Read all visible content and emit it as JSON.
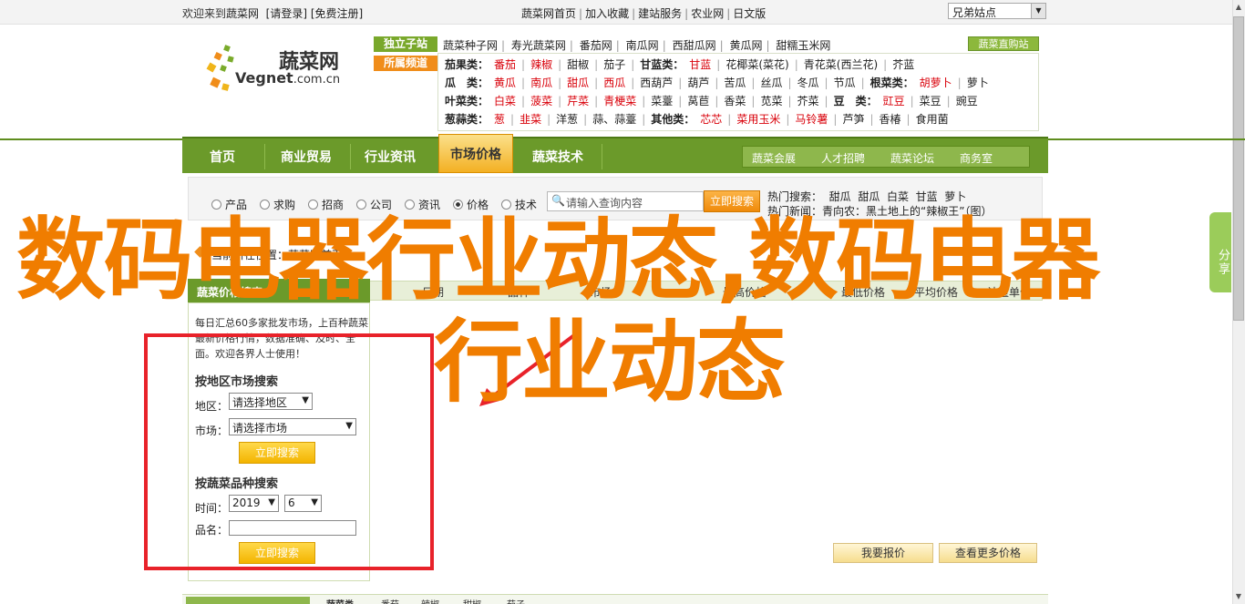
{
  "topbar": {
    "welcome": "欢迎来到",
    "site": "蔬菜网",
    "login": "[请登录]",
    "register": "[免费注册]",
    "links": [
      "蔬菜网首页",
      "加入收藏",
      "建站服务",
      "农业网",
      "日文版"
    ],
    "skin": "兄弟姑点"
  },
  "logo": {
    "cn": "蔬菜网",
    "en_a": "Vegnet",
    "en_b": ".com.cn"
  },
  "header": {
    "tag1": "独立子站",
    "tag2": "所属频道",
    "sites": [
      "蔬菜种子网",
      "寿光蔬菜网",
      "番茄网",
      "南瓜网",
      "西甜瓜网",
      "黄瓜网",
      "甜糯玉米网"
    ],
    "direct": "蔬菜直购站"
  },
  "veg_rows": [
    {
      "head": "茄果类：",
      "items": [
        [
          "番茄",
          true
        ],
        [
          "辣椒",
          true
        ],
        [
          "甜椒",
          false
        ],
        [
          "茄子",
          false
        ]
      ],
      "head2": "甘蓝类：",
      "items2": [
        [
          "甘蓝",
          true
        ],
        [
          "花椰菜(菜花)",
          false
        ],
        [
          "青花菜(西兰花)",
          false
        ],
        [
          "芥蓝",
          false
        ]
      ]
    },
    {
      "head": "瓜　类：",
      "items": [
        [
          "黄瓜",
          true
        ],
        [
          "南瓜",
          true
        ],
        [
          "甜瓜",
          true
        ],
        [
          "西瓜",
          true
        ],
        [
          "西葫芦",
          false
        ],
        [
          "葫芦",
          false
        ],
        [
          "苦瓜",
          false
        ],
        [
          "丝瓜",
          false
        ],
        [
          "冬瓜",
          false
        ],
        [
          "节瓜",
          false
        ]
      ],
      "head2": "根菜类：",
      "items2": [
        [
          "胡萝卜",
          true
        ],
        [
          "萝卜",
          false
        ]
      ]
    },
    {
      "head": "叶菜类：",
      "items": [
        [
          "白菜",
          true
        ],
        [
          "菠菜",
          true
        ],
        [
          "芹菜",
          true
        ],
        [
          "青梗菜",
          true
        ],
        [
          "菜薹",
          false
        ],
        [
          "莴苣",
          false
        ],
        [
          "香菜",
          false
        ],
        [
          "苋菜",
          false
        ],
        [
          "芥菜",
          false
        ]
      ],
      "head2": "豆　类：",
      "items2": [
        [
          "豇豆",
          true
        ],
        [
          "菜豆",
          false
        ],
        [
          "豌豆",
          false
        ]
      ]
    },
    {
      "head": "葱蒜类：",
      "items": [
        [
          "葱",
          true
        ],
        [
          "韭菜",
          true
        ],
        [
          "洋葱",
          false
        ],
        [
          "蒜、蒜薹",
          false
        ]
      ],
      "head2": "其他类：",
      "items2": [
        [
          "芯芯",
          true
        ],
        [
          "菜用玉米",
          true
        ],
        [
          "马铃薯",
          true
        ],
        [
          "芦笋",
          false
        ],
        [
          "香椿",
          false
        ],
        [
          "食用菌",
          false
        ]
      ]
    }
  ],
  "nav": {
    "items": [
      "首页",
      "商业贸易",
      "行业资讯",
      "市场价格",
      "蔬菜技术"
    ],
    "active": "市场价格",
    "sub": [
      "蔬菜会展",
      "人才招聘",
      "蔬菜论坛",
      "商务室"
    ]
  },
  "search": {
    "options": [
      "产品",
      "求购",
      "招商",
      "公司",
      "资讯",
      "价格",
      "技术"
    ],
    "selected": "价格",
    "placeholder": "请输入查询内容",
    "button": "立即搜索",
    "hot_label": "热门搜索：",
    "hot": [
      "甜瓜",
      "甜瓜",
      "白菜",
      "甘蓝",
      "萝卜"
    ],
    "news_label": "热门新闻：",
    "news": "青向农：黑土地上的“辣椒王”（图）"
  },
  "crumb": "当前所在位置：蔬菜网首页 >",
  "tabs": {
    "left": "蔬菜价格搜索",
    "cols": [
      "日期",
      "品种",
      "市场",
      "最高价格",
      "最低价格",
      "平均价格",
      "计量单位"
    ]
  },
  "left_panel": {
    "intro": "每日汇总60多家批发市场，上百种蔬菜最新价格行情，数据准确、及时、全面。欢迎各界人士使用！",
    "region_head": "按地区市场搜索",
    "region_label": "地区：",
    "region_value": "请选择地区",
    "market_label": "市场：",
    "market_value": "请选择市场",
    "button": "立即搜索",
    "variety_head": "按蔬菜品种搜索",
    "time_label": "时间：",
    "year": "2019",
    "month": "6",
    "name_label": "品名："
  },
  "right_panel": {
    "btn1": "我要报价",
    "btn2": "查看更多价格"
  },
  "bottom": {
    "label": "蔬菜类",
    "items": [
      "番茄",
      "辣椒",
      "甜椒",
      "茄子"
    ]
  },
  "share": "分享",
  "overlay": {
    "line1": "数码电器行业动态,数码电器",
    "line2": "行业动态"
  },
  "colors": {
    "green": "#6b9a2a",
    "orange": "#f08d1a",
    "overlay": "#f07d00",
    "red_box": "#e8222a"
  }
}
